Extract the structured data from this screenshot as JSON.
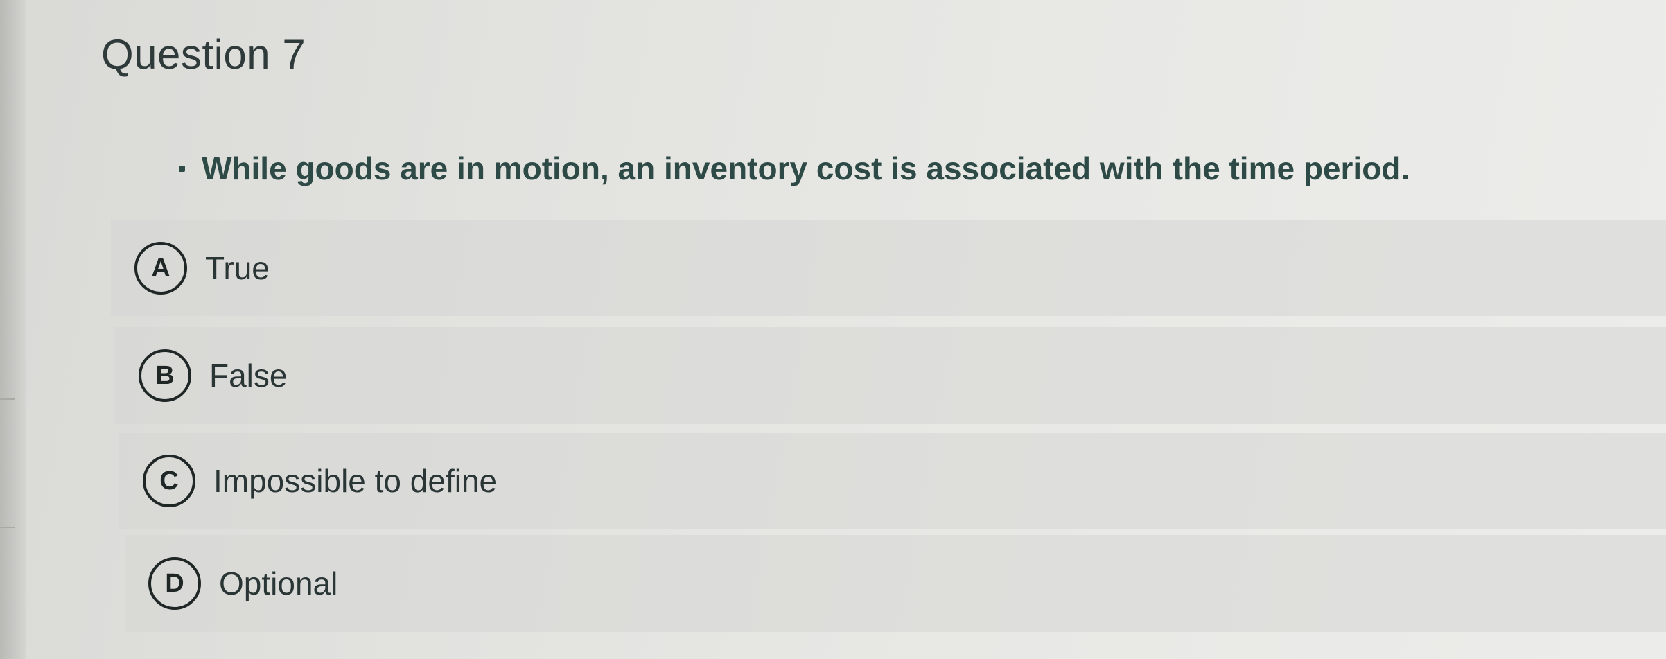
{
  "question": {
    "title": "Question 7",
    "prompt": "While goods are in motion, an inventory cost is associated with the time period."
  },
  "options": [
    {
      "letter": "A",
      "label": "True"
    },
    {
      "letter": "B",
      "label": "False"
    },
    {
      "letter": "C",
      "label": "Impossible to define"
    },
    {
      "letter": "D",
      "label": "Optional"
    }
  ],
  "colors": {
    "prompt_text": "#2e4a46",
    "title_text": "#2f3a3a",
    "background": "#e4e4e1"
  }
}
